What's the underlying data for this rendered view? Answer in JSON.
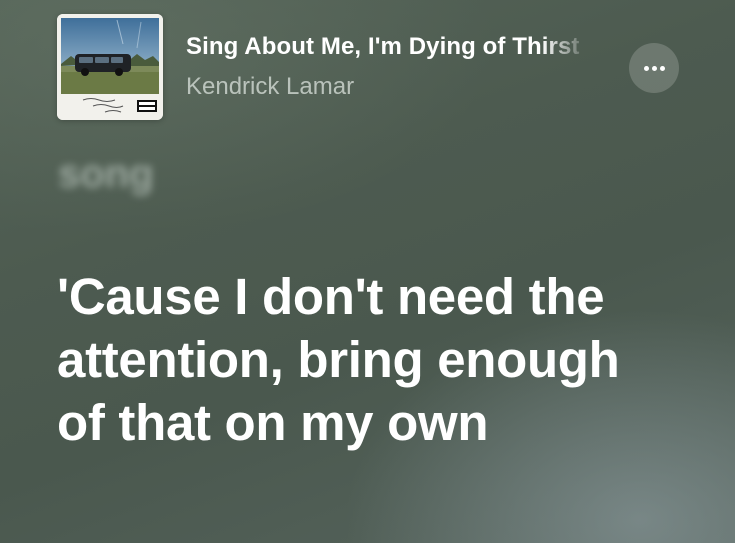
{
  "now_playing": {
    "title": "Sing About Me, I'm Dying of Thirst",
    "artist": "Kendrick Lamar",
    "album_art_icon": "album-cover-art",
    "more_icon": "ellipsis-icon"
  },
  "lyrics": {
    "previous_line": "song",
    "current_line": "'Cause I don't need the attention, bring enough of that on my own"
  },
  "colors": {
    "background": "#4d5b50",
    "text_active": "#ffffff",
    "text_secondary": "#e1e8e2"
  }
}
